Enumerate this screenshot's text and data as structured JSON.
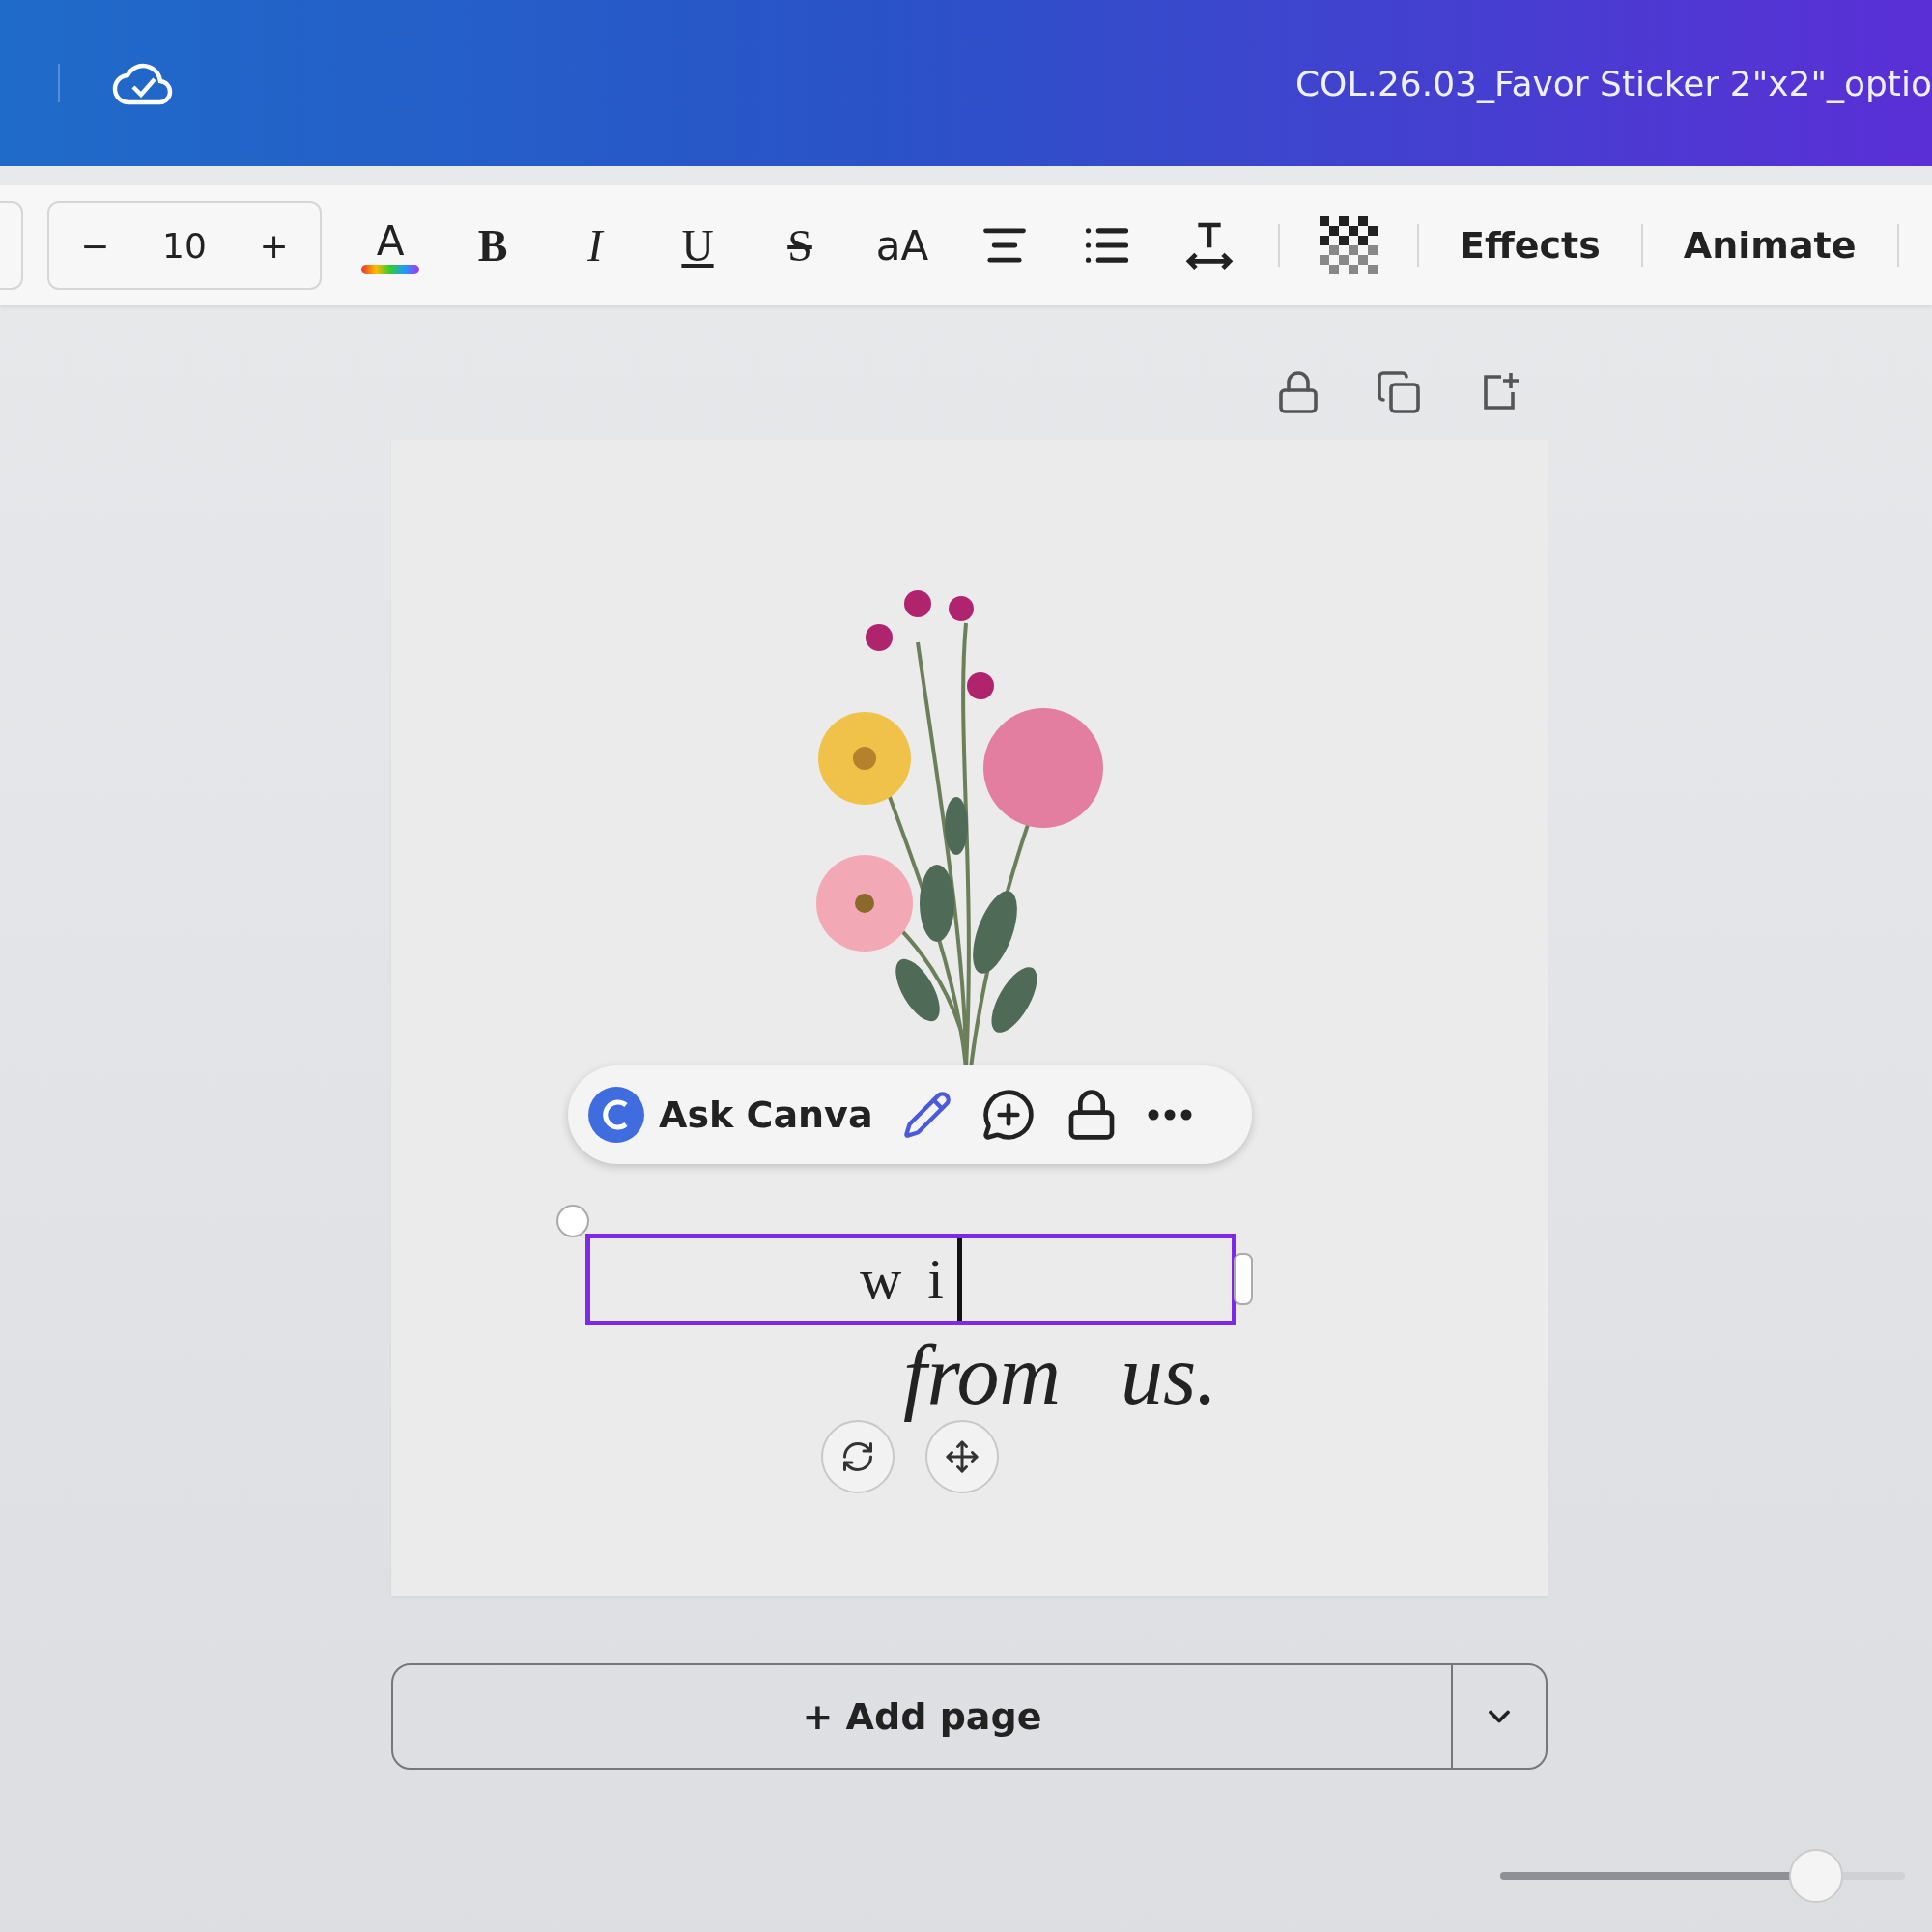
{
  "top_bar": {
    "file_title": "COL.26.03_Favor Sticker 2\"x2\"_optio"
  },
  "toolbar": {
    "font_size": {
      "decrease": "−",
      "value": "10",
      "increase": "+"
    },
    "format_buttons": [
      {
        "kind": "color",
        "label": "A"
      },
      {
        "kind": "bold",
        "label": "B"
      },
      {
        "kind": "italic",
        "label": "I"
      },
      {
        "kind": "underline",
        "label": "U"
      },
      {
        "kind": "strike",
        "label": "S"
      },
      {
        "kind": "case",
        "label": "aA"
      },
      {
        "kind": "align"
      },
      {
        "kind": "list"
      },
      {
        "kind": "spacing"
      },
      {
        "kind": "transparency"
      }
    ],
    "text_buttons": [
      "Effects",
      "Animate"
    ]
  },
  "canvas": {
    "floating_toolbar": {
      "ask_label": "Ask Canva"
    },
    "text_box": {
      "value": "w i"
    },
    "script_text": "from us."
  },
  "add_page": {
    "label": "+ Add page"
  },
  "zoom_slider": {
    "level": 0.78
  }
}
